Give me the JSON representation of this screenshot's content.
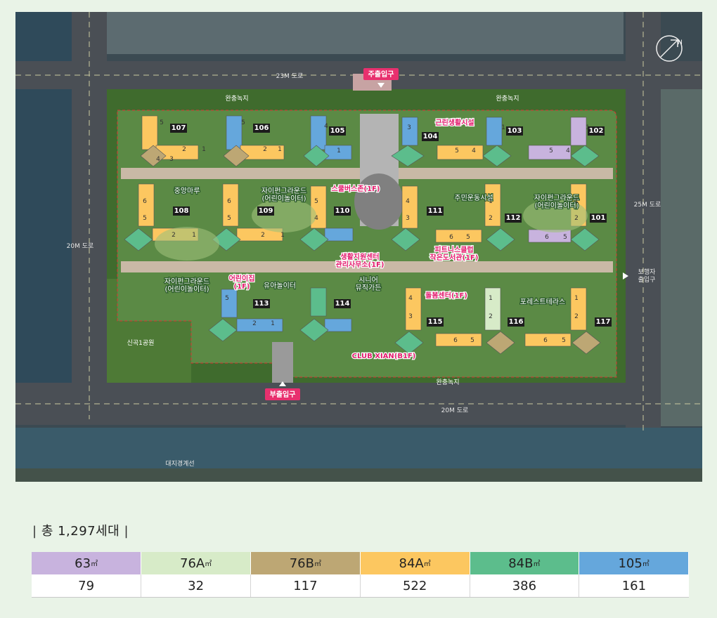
{
  "map": {
    "roads": {
      "north": "23M 도로",
      "west": "20M 도로",
      "east": "25M 도로",
      "south": "20M 도로"
    },
    "greens": {
      "north_left": "완충녹지",
      "north_right": "완충녹지",
      "south": "완충녹지"
    },
    "entrances": {
      "main": "주출입구",
      "sub": "부출입구",
      "pedestrian": "보행자\n출입구"
    },
    "park": "신곡1공원",
    "site_line": "대지경계선",
    "compass": "N",
    "buildings": [
      "101",
      "102",
      "103",
      "104",
      "105",
      "106",
      "107",
      "108",
      "109",
      "110",
      "111",
      "112",
      "113",
      "114",
      "115",
      "116",
      "117"
    ],
    "facilities": [
      "근린생활시설",
      "스쿨버스존(1F)",
      "생활지원센터\n관리사무소(1F)",
      "어린이집\n(1F)",
      "피트니스클럽\n작은도서관(1F)",
      "돌봄센터(1F)",
      "CLUB XIAN(B1F)"
    ],
    "landscape": [
      "중앙마루",
      "자이펀그라운드\n(어린이놀이터)",
      "주민운동시설",
      "자이펀그라운드\n(어린이놀이터)",
      "자이펀그라운드\n(어린이놀이터)",
      "유아놀이터",
      "시니어\n뮤직가든",
      "포레스트테라스"
    ]
  },
  "summary": {
    "title": "총 1,297세대"
  },
  "legend": [
    {
      "type": "63㎡",
      "count": "79",
      "color": "#c8b3de"
    },
    {
      "type": "76A㎡",
      "count": "32",
      "color": "#d7ebc8"
    },
    {
      "type": "76B㎡",
      "count": "117",
      "color": "#bda774"
    },
    {
      "type": "84A㎡",
      "count": "522",
      "color": "#fcc760"
    },
    {
      "type": "84B㎡",
      "count": "386",
      "color": "#5cbd8c"
    },
    {
      "type": "105㎡",
      "count": "161",
      "color": "#65a7dc"
    }
  ]
}
